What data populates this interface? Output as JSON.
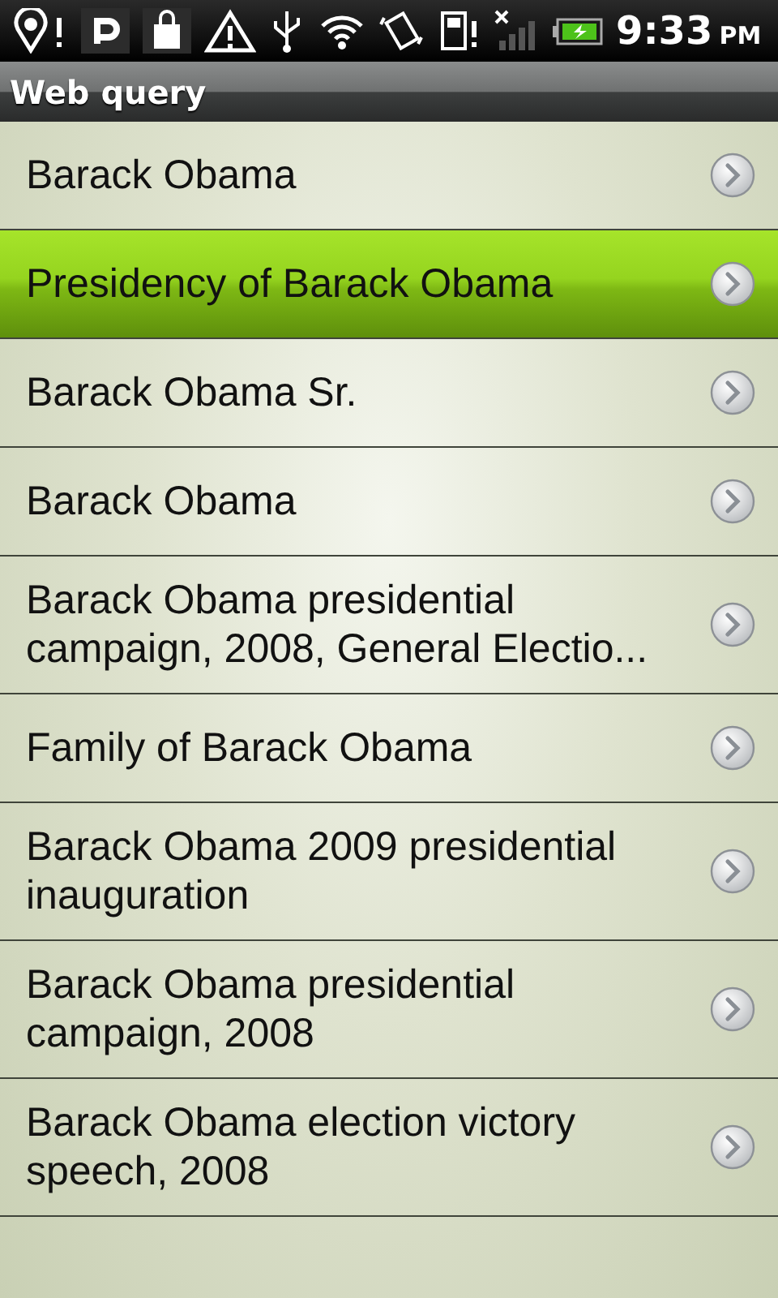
{
  "status_bar": {
    "time": "9:33",
    "ampm": "PM"
  },
  "title_bar": {
    "title": "Web query"
  },
  "results": [
    {
      "label": "Barack Obama",
      "selected": false
    },
    {
      "label": "Presidency of Barack Obama",
      "selected": true
    },
    {
      "label": "Barack Obama Sr.",
      "selected": false
    },
    {
      "label": "Barack Obama",
      "selected": false
    },
    {
      "label": "Barack Obama presidential campaign, 2008, General Electio...",
      "selected": false
    },
    {
      "label": "Family of Barack Obama",
      "selected": false
    },
    {
      "label": "Barack Obama 2009 presidential inauguration",
      "selected": false
    },
    {
      "label": "Barack Obama presidential campaign, 2008",
      "selected": false
    },
    {
      "label": "Barack Obama election victory speech, 2008",
      "selected": false
    }
  ]
}
